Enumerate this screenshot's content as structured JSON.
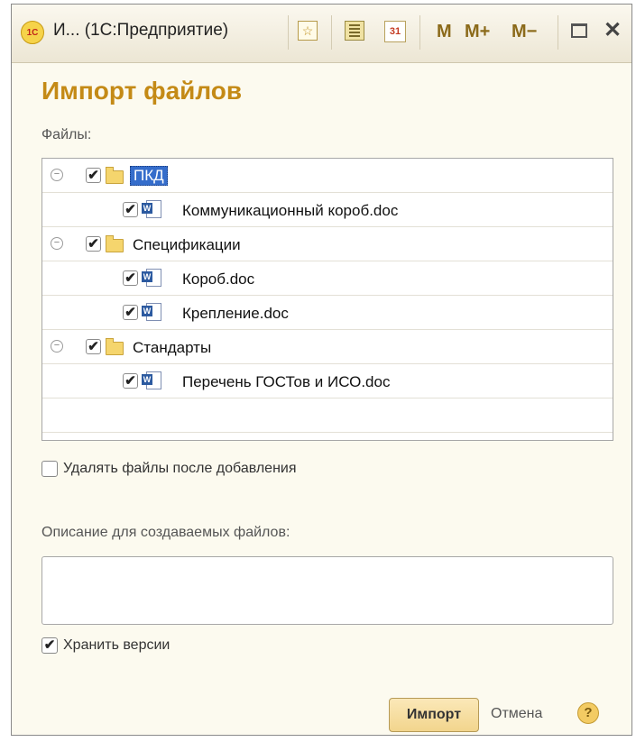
{
  "window": {
    "title": "И... (1С:Предприятие)",
    "logo_text": "1С",
    "toolbar": {
      "favorite_glyph": "☆",
      "calendar_day": "31",
      "m_label": "M",
      "m_plus_label": "M+",
      "m_minus_label": "M−",
      "close_glyph": "✕"
    }
  },
  "form": {
    "heading": "Импорт файлов",
    "files_label": "Файлы:",
    "tree": [
      {
        "type": "folder",
        "label": "ПКД",
        "checked": true,
        "selected": true,
        "collapse_glyph": "−"
      },
      {
        "type": "file",
        "label": "Коммуникационный короб.doc",
        "checked": true
      },
      {
        "type": "folder",
        "label": "Спецификации",
        "checked": true,
        "collapse_glyph": "−"
      },
      {
        "type": "file",
        "label": "Короб.doc",
        "checked": true
      },
      {
        "type": "file",
        "label": "Крепление.doc",
        "checked": true
      },
      {
        "type": "folder",
        "label": "Стандарты",
        "checked": true,
        "collapse_glyph": "−"
      },
      {
        "type": "file",
        "label": "Перечень ГОСТов и ИСО.doc",
        "checked": true
      }
    ],
    "check_glyph": "✔",
    "doc_icon_letter": "W",
    "delete_after_add": {
      "label": "Удалять файлы после добавления",
      "checked": false
    },
    "description_label": "Описание для создаваемых файлов:",
    "description_value": "",
    "keep_versions": {
      "label": "Хранить версии",
      "checked": true
    },
    "import_button": "Импорт",
    "cancel_link": "Отмена",
    "help_glyph": "?"
  },
  "colors": {
    "heading": "#c48a16",
    "selection": "#356dcb",
    "window_bg": "#fcfaef"
  }
}
